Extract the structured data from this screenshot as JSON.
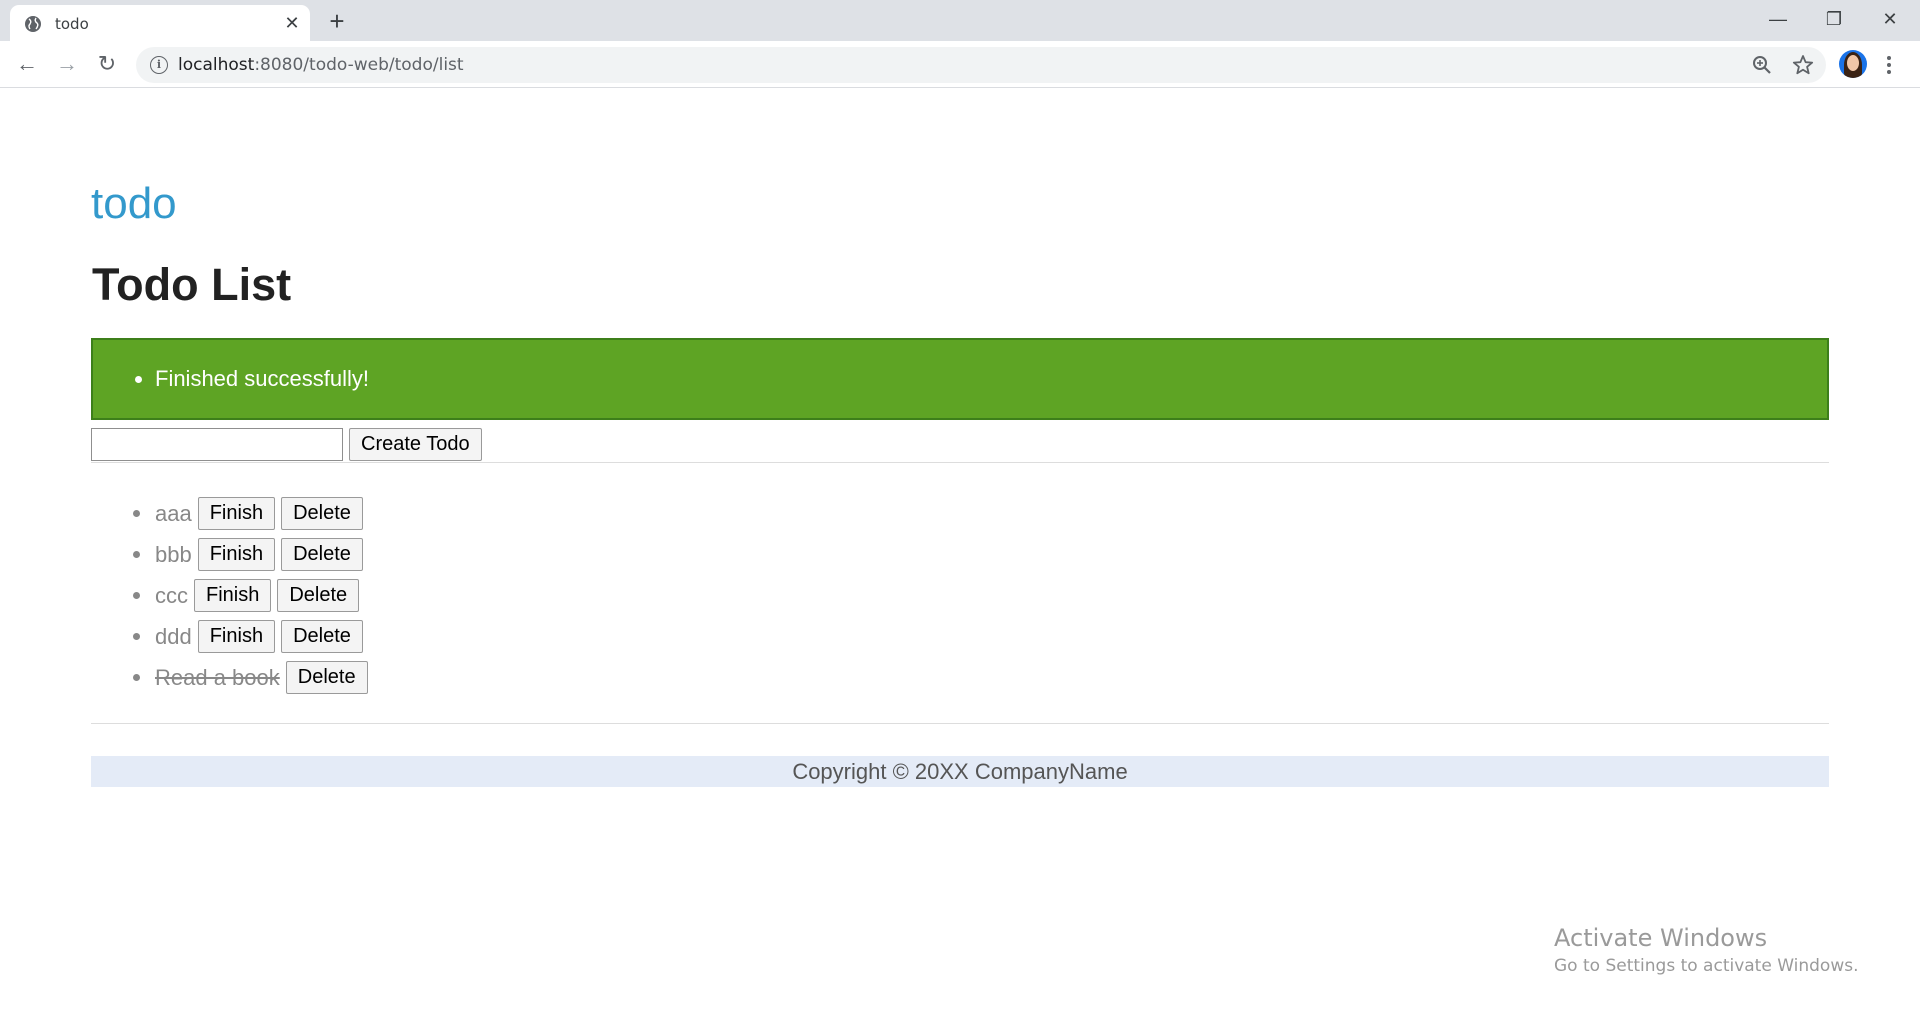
{
  "browser": {
    "tab_title": "todo",
    "tab_close": "✕",
    "new_tab": "+",
    "window_controls": [
      "—",
      "❐",
      "✕"
    ],
    "nav": {
      "back": "←",
      "forward": "→",
      "reload": "↻"
    },
    "url_host": "localhost",
    "url_path": ":8080/todo-web/todo/list",
    "icons": [
      "globe-icon",
      "info-icon",
      "zoom-icon",
      "star-icon",
      "avatar",
      "menu-icon"
    ]
  },
  "page": {
    "brand": "todo",
    "heading": "Todo List",
    "alert_message": "Finished successfully!",
    "input_value": "",
    "create_button": "Create Todo",
    "todos": [
      {
        "title": "aaa",
        "finished": false,
        "finish_label": "Finish",
        "delete_label": "Delete"
      },
      {
        "title": "bbb",
        "finished": false,
        "finish_label": "Finish",
        "delete_label": "Delete"
      },
      {
        "title": "ccc",
        "finished": false,
        "finish_label": "Finish",
        "delete_label": "Delete"
      },
      {
        "title": "ddd",
        "finished": false,
        "finish_label": "Finish",
        "delete_label": "Delete"
      },
      {
        "title": "Read a book",
        "finished": true,
        "delete_label": "Delete"
      }
    ],
    "footer": "Copyright © 20XX CompanyName"
  },
  "watermark": {
    "title": "Activate Windows",
    "subtitle": "Go to Settings to activate Windows."
  },
  "colors": {
    "brand": "#3399cc",
    "alert_bg": "#5ea424",
    "footer_bg": "#e4ebf7"
  }
}
